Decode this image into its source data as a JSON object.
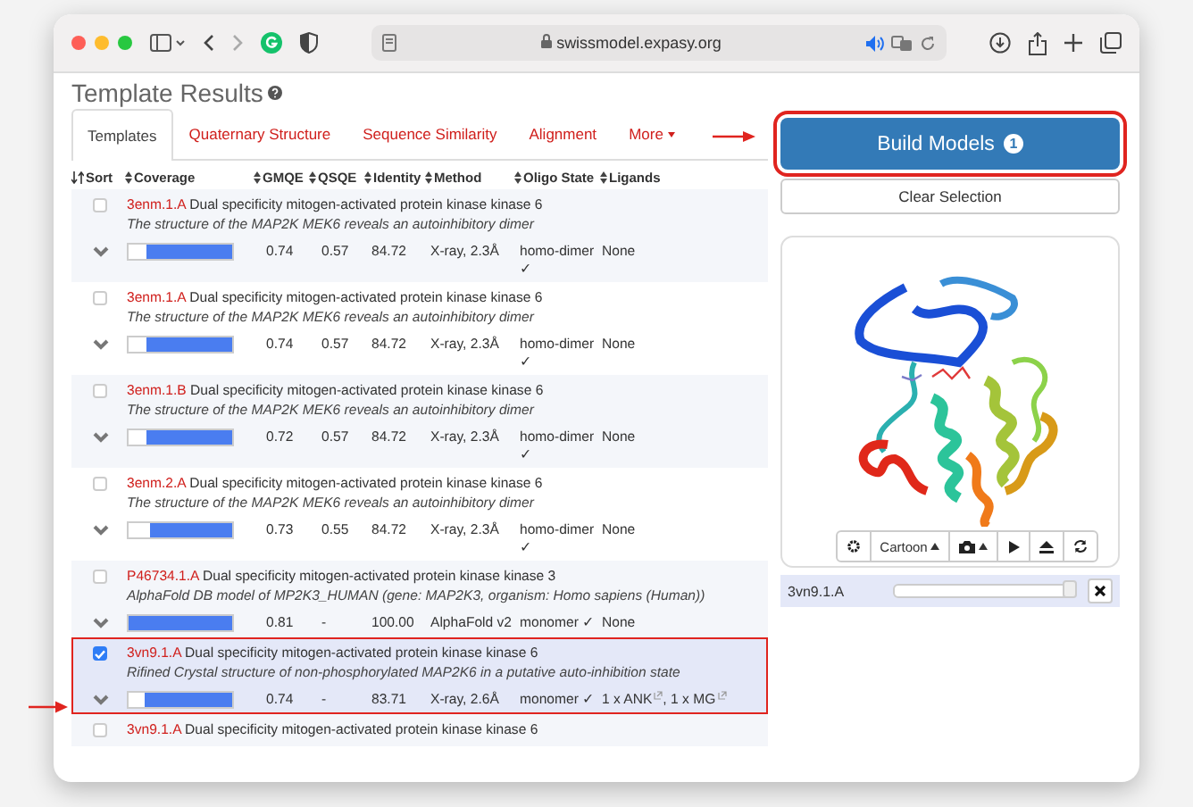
{
  "browser": {
    "url": "swissmodel.expasy.org"
  },
  "page": {
    "title": "Template Results"
  },
  "tabs": [
    {
      "label": "Templates",
      "selected": true,
      "kind": "plain"
    },
    {
      "label": "Quaternary Structure",
      "selected": false,
      "kind": "plain"
    },
    {
      "label": "Sequence Similarity",
      "selected": false,
      "kind": "plain"
    },
    {
      "label": "Alignment",
      "selected": false,
      "kind": "plain"
    },
    {
      "label": "More",
      "selected": false,
      "kind": "dropdown"
    }
  ],
  "actions": {
    "build_label": "Build Models",
    "build_count": "1",
    "clear_label": "Clear Selection"
  },
  "columns": [
    "Sort",
    "Coverage",
    "GMQE",
    "QSQE",
    "Identity",
    "Method",
    "Oligo State",
    "Ligands"
  ],
  "templates": [
    {
      "id": "3enm.1.A",
      "name": "Dual specificity mitogen-activated protein kinase kinase 6",
      "description": "The structure of the MAP2K MEK6 reveals an autoinhibitory dimer",
      "selected": false,
      "coverage": {
        "level": 0.83
      },
      "gmqe": "0.74",
      "qsqe": "0.57",
      "identity": "84.72",
      "method": "X-ray, 2.3Å",
      "oligo_state": "homo-dimer ✓",
      "ligands": [
        {
          "text": "None",
          "external_link": false
        }
      ]
    },
    {
      "id": "3enm.1.A",
      "name": "Dual specificity mitogen-activated protein kinase kinase 6",
      "description": "The structure of the MAP2K MEK6 reveals an autoinhibitory dimer",
      "selected": false,
      "coverage": {
        "level": 0.83
      },
      "gmqe": "0.74",
      "qsqe": "0.57",
      "identity": "84.72",
      "method": "X-ray, 2.3Å",
      "oligo_state": "homo-dimer ✓",
      "ligands": [
        {
          "text": "None",
          "external_link": false
        }
      ]
    },
    {
      "id": "3enm.1.B",
      "name": "Dual specificity mitogen-activated protein kinase kinase 6",
      "description": "The structure of the MAP2K MEK6 reveals an autoinhibitory dimer",
      "selected": false,
      "coverage": {
        "level": 0.83
      },
      "gmqe": "0.72",
      "qsqe": "0.57",
      "identity": "84.72",
      "method": "X-ray, 2.3Å",
      "oligo_state": "homo-dimer ✓",
      "ligands": [
        {
          "text": "None",
          "external_link": false
        }
      ]
    },
    {
      "id": "3enm.2.A",
      "name": "Dual specificity mitogen-activated protein kinase kinase 6",
      "description": "The structure of the MAP2K MEK6 reveals an autoinhibitory dimer",
      "selected": false,
      "coverage": {
        "level": 0.8
      },
      "gmqe": "0.73",
      "qsqe": "0.55",
      "identity": "84.72",
      "method": "X-ray, 2.3Å",
      "oligo_state": "homo-dimer ✓",
      "ligands": [
        {
          "text": "None",
          "external_link": false
        }
      ]
    },
    {
      "id": "P46734.1.A",
      "name": "Dual specificity mitogen-activated protein kinase kinase 3",
      "description": "AlphaFold DB model of MP2K3_HUMAN (gene: MAP2K3, organism: Homo sapiens (Human))",
      "selected": false,
      "coverage": {
        "level": 1
      },
      "gmqe": "0.81",
      "qsqe": "-",
      "identity": "100.00",
      "method": "AlphaFold v2",
      "oligo_state": "monomer ✓",
      "ligands": [
        {
          "text": "None",
          "external_link": false
        }
      ]
    },
    {
      "id": "3vn9.1.A",
      "name": "Dual specificity mitogen-activated protein kinase kinase 6",
      "description": "Rifined Crystal structure of non-phosphorylated MAP2K6 in a putative auto-inhibition state",
      "selected": true,
      "coverage": {
        "level": 0.84
      },
      "gmqe": "0.74",
      "qsqe": "-",
      "identity": "83.71",
      "method": "X-ray, 2.6Å",
      "oligo_state": "monomer ✓",
      "ligands": [
        {
          "text": "1 x ANK",
          "external_link": true
        },
        {
          "text": ", 1 x MG",
          "external_link": true
        }
      ]
    },
    {
      "id": "3vn9.1.A",
      "name": "Dual specificity mitogen-activated protein kinase kinase 6",
      "selected": false
    }
  ],
  "viewer": {
    "controls": [
      {
        "kind": "settings"
      },
      {
        "kind": "menu",
        "label": "Cartoon"
      },
      {
        "kind": "camera"
      },
      {
        "kind": "play"
      },
      {
        "kind": "eject"
      },
      {
        "kind": "reset"
      }
    ],
    "chain": {
      "label": "3vn9.1.A",
      "level": 0.97
    }
  }
}
